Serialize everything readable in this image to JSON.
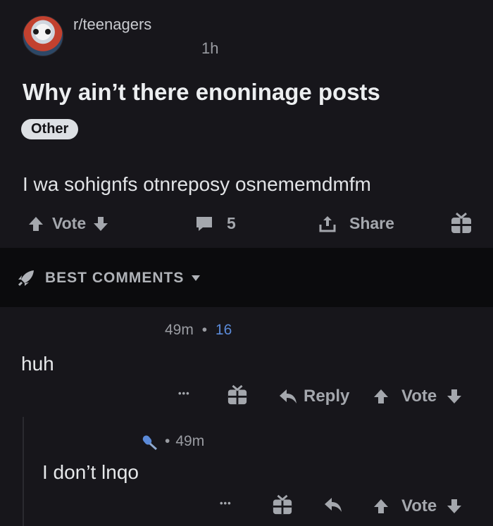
{
  "post": {
    "subreddit": "r/teenagers",
    "time": "1h",
    "title": "Why ain’t there enoninage posts",
    "flair": "Other",
    "body": "I wa sohignfs otnreposy osnememdmfm",
    "actions": {
      "vote_label": "Vote",
      "comment_count": "5",
      "share_label": "Share"
    }
  },
  "sort": {
    "label": "BEST COMMENTS"
  },
  "comments": [
    {
      "time": "49m",
      "dot": "•",
      "score": "16",
      "text": "huh",
      "more": "•••",
      "reply_label": "Reply",
      "vote_label": "Vote"
    },
    {
      "dot": "•",
      "time": "49m",
      "text": "I don’t lnqo",
      "more": "•••",
      "vote_label": "Vote"
    }
  ],
  "colors": {
    "background": "#17161b",
    "separator": "#0b0b0d",
    "accent": "#5b8ad8"
  }
}
